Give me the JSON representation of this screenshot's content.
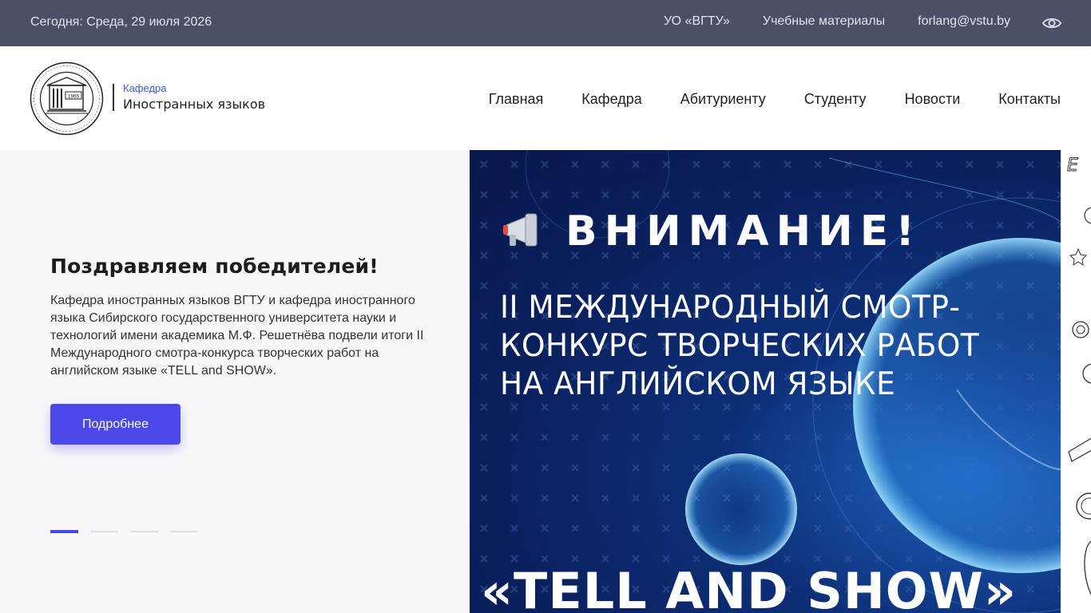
{
  "topbar": {
    "date": "Сегодня: Среда, 29 июля 2026",
    "links": [
      "УО «ВГТУ»",
      "Учебные материалы",
      "forlang@vstu.by"
    ],
    "eye_icon": "eye-icon"
  },
  "header": {
    "logo_year": "1965",
    "brand_sub": "Кафедра",
    "brand_main": "Иностранных языков",
    "nav": [
      "Главная",
      "Кафедра",
      "Абитуриенту",
      "Студенту",
      "Новости",
      "Контакты"
    ]
  },
  "hero": {
    "title": "Поздравляем победителей!",
    "text": "Кафедра иностранных языков ВГТУ и кафедра иностранного языка Сибирского государственного университета науки и технологий имени академика М.Ф. Решетнёва подвели итоги II Международного смотра-конкурса творческих работ на английском языке «TELL and SHOW».",
    "button": "Подробнее",
    "slides_total": 4,
    "active_slide": 1
  },
  "banner": {
    "attention": "ВНИМАНИЕ!",
    "headline": "II МЕЖДУНАРОДНЫЙ СМОТР-КОНКУРС ТВОРЧЕСКИХ РАБОТ НА АНГЛИЙСКОМ ЯЗЫКЕ",
    "tell": "«TELL AND SHOW»",
    "megaphone_icon": "megaphone-icon"
  },
  "colors": {
    "topbar": "#4a5068",
    "accent": "#4b47e8",
    "brand_sub": "#3b5bd6",
    "banner": "#0a1f5c"
  }
}
